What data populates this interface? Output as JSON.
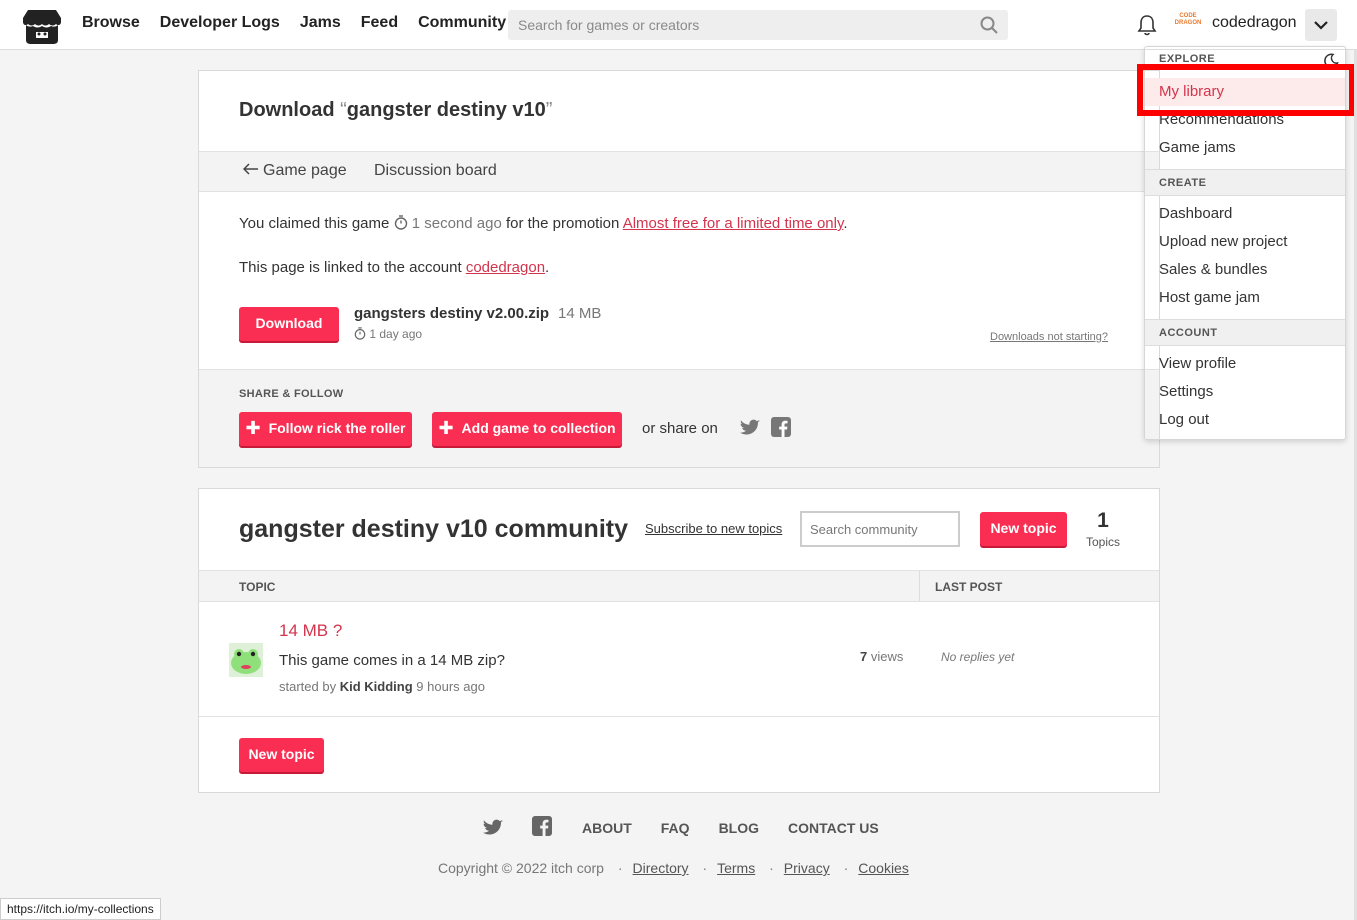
{
  "header": {
    "nav": [
      "Browse",
      "Developer Logs",
      "Jams",
      "Feed",
      "Community"
    ],
    "search_placeholder": "Search for games or creators",
    "username": "codedragon",
    "avatar_text": "CODE DRAGON"
  },
  "dropdown": {
    "explore_label": "EXPLORE",
    "explore_items": [
      "My library",
      "Recommendations",
      "Game jams"
    ],
    "create_label": "CREATE",
    "create_items": [
      "Dashboard",
      "Upload new project",
      "Sales & bundles",
      "Host game jam"
    ],
    "account_label": "ACCOUNT",
    "account_items": [
      "View profile",
      "Settings",
      "Log out"
    ]
  },
  "download": {
    "title_prefix": "Download ",
    "open_quote": "“",
    "game_name": "gangster destiny v10",
    "close_quote": "”",
    "tab_game_page": "Game page",
    "tab_discussion": "Discussion board",
    "claim_text": "You claimed this game",
    "claim_time": "1 second ago",
    "claim_for": "for the promotion",
    "promotion": "Almost free for a limited time only",
    "linked_text": "This page is linked to the account",
    "linked_account": "codedragon",
    "download_button": "Download",
    "file_name": "gangsters destiny v2.00.zip",
    "file_size": "14 MB",
    "file_date": "1 day ago",
    "not_starting": "Downloads not starting?",
    "share_label": "SHARE & FOLLOW",
    "follow_button": "Follow rick the roller",
    "collection_button": "Add game to collection",
    "share_on": "or share on"
  },
  "community": {
    "title": "gangster destiny v10 community",
    "subscribe": "Subscribe to new topics",
    "search_placeholder": "Search community",
    "new_topic_button": "New topic",
    "topics_count": "1",
    "topics_label": "Topics",
    "col_topic": "TOPIC",
    "col_last_post": "LAST POST",
    "topics": [
      {
        "title": "14 MB ?",
        "excerpt": "This game comes in a 14 MB zip?",
        "started_by": "started by",
        "author": "Kid Kidding",
        "time": "9 hours ago",
        "views_count": "7",
        "views_label": "views",
        "last_post": "No replies yet"
      }
    ],
    "new_topic_button_bottom": "New topic"
  },
  "footer": {
    "links": [
      "ABOUT",
      "FAQ",
      "BLOG",
      "CONTACT US"
    ],
    "copyright": "Copyright © 2022 itch corp",
    "legal": [
      "Directory",
      "Terms",
      "Privacy",
      "Cookies"
    ]
  },
  "status_url": "https://itch.io/my-collections",
  "colors": {
    "accent": "#fa2e52",
    "link": "#d3344d",
    "highlight": "#ff0000"
  }
}
